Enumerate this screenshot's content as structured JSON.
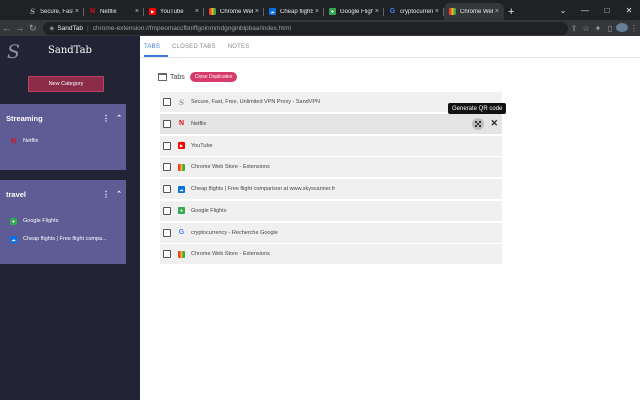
{
  "browser": {
    "tabs": [
      {
        "title": "Secure, Fast, Free",
        "favicon": "sandvpn-favicon",
        "color": "#7c7c7c",
        "active": false
      },
      {
        "title": "Netflix",
        "favicon": "netflix-favicon",
        "color": "#e50914",
        "active": false
      },
      {
        "title": "YouTube",
        "favicon": "youtube-favicon",
        "color": "#ff0000",
        "active": false
      },
      {
        "title": "Chrome Web",
        "favicon": "chrome-web-store-favicon",
        "color": "#fbbc04",
        "active": false
      },
      {
        "title": "Cheap flights |",
        "favicon": "skyscanner-favicon",
        "color": "#0770e3",
        "active": false
      },
      {
        "title": "Google Flights",
        "favicon": "google-flights-favicon",
        "color": "#34a853",
        "active": false
      },
      {
        "title": "cryptocurrency",
        "favicon": "google-favicon",
        "color": "#4285f4",
        "active": false
      },
      {
        "title": "Chrome Web",
        "favicon": "chrome-web-store-favicon",
        "color": "#fbbc04",
        "active": false
      }
    ],
    "omnibox": {
      "chip": "SandTab",
      "url": "chrome-extension://fmpeomaccfbnlffgoinmmdgnginblpbaa/index.html"
    }
  },
  "sidebar": {
    "brand": "SandTab",
    "logo_letter": "S",
    "new_category_label": "New Category",
    "categories": [
      {
        "name": "Streaming",
        "items": [
          {
            "label": "Netflix",
            "favicon": "netflix-icon",
            "color": "#e50914"
          }
        ]
      },
      {
        "name": "travel",
        "items": [
          {
            "label": "Google Flights",
            "favicon": "google-flights-icon",
            "color": "#34a853"
          },
          {
            "label": "Cheap flights | Free flight compa...",
            "favicon": "skyscanner-icon",
            "color": "#0770e3"
          }
        ]
      }
    ]
  },
  "main": {
    "tabs": [
      {
        "label": "TABS",
        "active": true
      },
      {
        "label": "CLOSED TABS",
        "active": false
      },
      {
        "label": "NOTES",
        "active": false
      }
    ],
    "section_title": "Tabs",
    "close_duplicates_label": "Close Duplicates",
    "tooltip": "Generate QR code",
    "rows": [
      {
        "title": "Secure, Fast, Free, Unlimited VPN Proxy - SandVPN",
        "favicon": "sandvpn-icon"
      },
      {
        "title": "Netflix",
        "favicon": "netflix-icon"
      },
      {
        "title": "YouTube",
        "favicon": "youtube-icon"
      },
      {
        "title": "Chrome Web Store - Extensions",
        "favicon": "chrome-web-store-icon"
      },
      {
        "title": "Cheap flights | Free flight comparison at www.skyscanner.fr",
        "favicon": "skyscanner-icon"
      },
      {
        "title": "Google Flights",
        "favicon": "google-flights-icon"
      },
      {
        "title": "cryptocurrency - Recherche Google",
        "favicon": "google-icon"
      },
      {
        "title": "Chrome Web Store - Extensions",
        "favicon": "chrome-web-store-icon"
      }
    ]
  }
}
